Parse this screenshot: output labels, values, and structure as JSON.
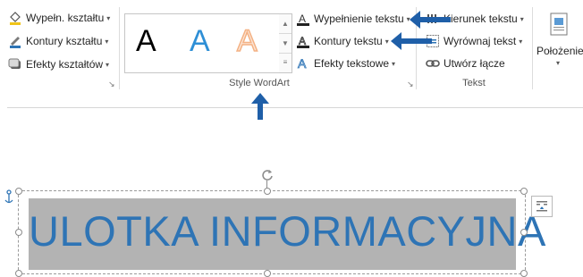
{
  "ribbon": {
    "shape_styles": {
      "fill": "Wypełn. kształtu",
      "outline": "Kontury kształtu",
      "effects": "Efekty kształtów"
    },
    "wordart_styles": {
      "group_label": "Style WordArt",
      "gallery": [
        "A",
        "A",
        "A"
      ],
      "text_fill": "Wypełnienie tekstu",
      "text_outline": "Kontury tekstu",
      "text_effects": "Efekty tekstowe"
    },
    "text": {
      "group_label": "Tekst",
      "direction": "Kierunek tekstu",
      "align": "Wyrównaj tekst",
      "link": "Utwórz łącze"
    },
    "arrange": {
      "position": "Położenie"
    }
  },
  "document": {
    "wordart_text": "ULOTKA INFORMACYJNA"
  },
  "colors": {
    "accent": "#1f5fa8",
    "wordart_blue": "#2e74b5",
    "wordart_orange": "#f4b183"
  }
}
